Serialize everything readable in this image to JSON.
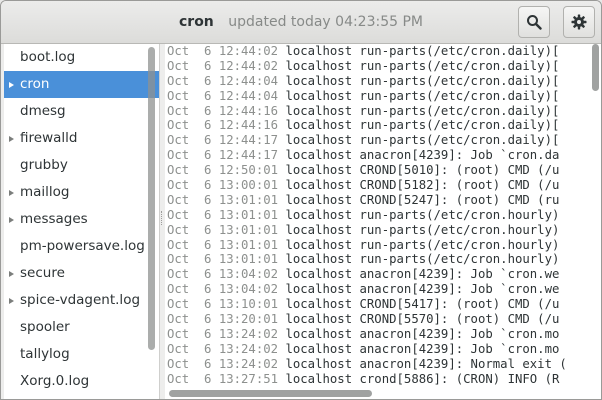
{
  "header": {
    "title": "cron",
    "subtitle": "updated today 04:23:55 PM",
    "search_icon": "search-icon",
    "gear_icon": "gear-icon"
  },
  "sidebar": {
    "items": [
      {
        "label": "boot.log",
        "expandable": false,
        "selected": false
      },
      {
        "label": "cron",
        "expandable": true,
        "selected": true
      },
      {
        "label": "dmesg",
        "expandable": false,
        "selected": false
      },
      {
        "label": "firewalld",
        "expandable": true,
        "selected": false
      },
      {
        "label": "grubby",
        "expandable": false,
        "selected": false
      },
      {
        "label": "maillog",
        "expandable": true,
        "selected": false
      },
      {
        "label": "messages",
        "expandable": true,
        "selected": false
      },
      {
        "label": "pm-powersave.log",
        "expandable": false,
        "selected": false
      },
      {
        "label": "secure",
        "expandable": true,
        "selected": false
      },
      {
        "label": "spice-vdagent.log",
        "expandable": true,
        "selected": false
      },
      {
        "label": "spooler",
        "expandable": false,
        "selected": false
      },
      {
        "label": "tallylog",
        "expandable": false,
        "selected": false
      },
      {
        "label": "Xorg.0.log",
        "expandable": false,
        "selected": false
      }
    ]
  },
  "log": {
    "lines": [
      {
        "ts": "Oct  6 12:44:02",
        "text": " localhost run-parts(/etc/cron.daily)["
      },
      {
        "ts": "Oct  6 12:44:02",
        "text": " localhost run-parts(/etc/cron.daily)["
      },
      {
        "ts": "Oct  6 12:44:04",
        "text": " localhost run-parts(/etc/cron.daily)["
      },
      {
        "ts": "Oct  6 12:44:04",
        "text": " localhost run-parts(/etc/cron.daily)["
      },
      {
        "ts": "Oct  6 12:44:16",
        "text": " localhost run-parts(/etc/cron.daily)["
      },
      {
        "ts": "Oct  6 12:44:16",
        "text": " localhost run-parts(/etc/cron.daily)["
      },
      {
        "ts": "Oct  6 12:44:17",
        "text": " localhost run-parts(/etc/cron.daily)["
      },
      {
        "ts": "Oct  6 12:44:17",
        "text": " localhost anacron[4239]: Job `cron.da"
      },
      {
        "ts": "Oct  6 12:50:01",
        "text": " localhost CROND[5010]: (root) CMD (/u"
      },
      {
        "ts": "Oct  6 13:00:01",
        "text": " localhost CROND[5182]: (root) CMD (/u"
      },
      {
        "ts": "Oct  6 13:01:01",
        "text": " localhost CROND[5247]: (root) CMD (ru"
      },
      {
        "ts": "Oct  6 13:01:01",
        "text": " localhost run-parts(/etc/cron.hourly)"
      },
      {
        "ts": "Oct  6 13:01:01",
        "text": " localhost run-parts(/etc/cron.hourly)"
      },
      {
        "ts": "Oct  6 13:01:01",
        "text": " localhost run-parts(/etc/cron.hourly)"
      },
      {
        "ts": "Oct  6 13:01:01",
        "text": " localhost run-parts(/etc/cron.hourly)"
      },
      {
        "ts": "Oct  6 13:04:02",
        "text": " localhost anacron[4239]: Job `cron.we"
      },
      {
        "ts": "Oct  6 13:04:02",
        "text": " localhost anacron[4239]: Job `cron.we"
      },
      {
        "ts": "Oct  6 13:10:01",
        "text": " localhost CROND[5417]: (root) CMD (/u"
      },
      {
        "ts": "Oct  6 13:20:01",
        "text": " localhost CROND[5570]: (root) CMD (/u"
      },
      {
        "ts": "Oct  6 13:24:02",
        "text": " localhost anacron[4239]: Job `cron.mo"
      },
      {
        "ts": "Oct  6 13:24:02",
        "text": " localhost anacron[4239]: Job `cron.mo"
      },
      {
        "ts": "Oct  6 13:24:02",
        "text": " localhost anacron[4239]: Normal exit ("
      },
      {
        "ts": "Oct  6 13:27:51",
        "text": " localhost crond[5886]: (CRON) INFO (R"
      }
    ]
  }
}
